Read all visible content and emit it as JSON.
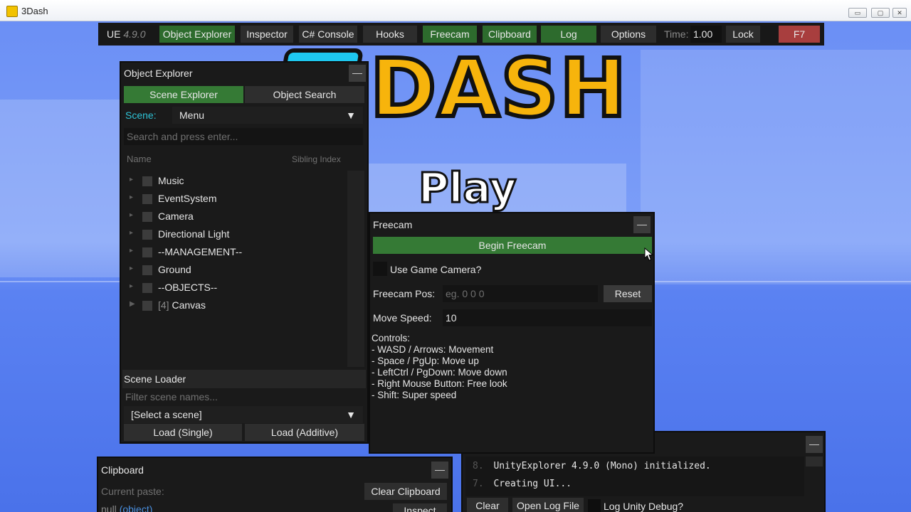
{
  "window": {
    "title": "3Dash",
    "minimize": "▭",
    "maximize": "▢",
    "close": "✕"
  },
  "game": {
    "logo": "DASH",
    "logo_d": "D",
    "play": "Play"
  },
  "navbar": {
    "ue_label": "UE",
    "version": "4.9.0",
    "tabs": [
      "Object Explorer",
      "Inspector",
      "C# Console",
      "Hooks",
      "Freecam",
      "Clipboard",
      "Log",
      "Options"
    ],
    "time_label": "Time:",
    "time_value": "1.00",
    "lock": "Lock",
    "f7": "F7"
  },
  "object_explorer": {
    "title": "Object Explorer",
    "minimize": "—",
    "tabs": [
      "Scene Explorer",
      "Object Search"
    ],
    "scene_label": "Scene:",
    "scene_value": "Menu",
    "dropdown_arrow": "▼",
    "search_placeholder": "Search and press enter...",
    "col_name": "Name",
    "col_sibling": "Sibling Index",
    "items": [
      {
        "arrow": "▸",
        "label": "Music",
        "count": ""
      },
      {
        "arrow": "▸",
        "label": "EventSystem",
        "count": ""
      },
      {
        "arrow": "▸",
        "label": "Camera",
        "count": ""
      },
      {
        "arrow": "▸",
        "label": "Directional Light",
        "count": ""
      },
      {
        "arrow": "▸",
        "label": "--MANAGEMENT--",
        "count": ""
      },
      {
        "arrow": "▸",
        "label": "Ground",
        "count": ""
      },
      {
        "arrow": "▸",
        "label": "--OBJECTS--",
        "count": ""
      },
      {
        "arrow": "▶",
        "label": "Canvas",
        "count": "[4]"
      }
    ],
    "scene_loader": {
      "title": "Scene Loader",
      "filter_placeholder": "Filter scene names...",
      "select_value": "[Select a scene]",
      "load_single": "Load (Single)",
      "load_additive": "Load (Additive)"
    }
  },
  "freecam": {
    "title": "Freecam",
    "minimize": "—",
    "begin": "Begin Freecam",
    "use_game_camera": "Use Game Camera?",
    "pos_label": "Freecam Pos:",
    "pos_placeholder": "eg. 0 0 0",
    "reset": "Reset",
    "speed_label": "Move Speed:",
    "speed_value": "10",
    "controls_title": "Controls:",
    "controls": [
      "- WASD / Arrows: Movement",
      "- Space / PgUp: Move up",
      "- LeftCtrl / PgDown: Move down",
      "- Right Mouse Button: Free look",
      "- Shift: Super speed"
    ]
  },
  "clipboard": {
    "title": "Clipboard",
    "minimize": "—",
    "current_paste_label": "Current paste:",
    "clear_button": "Clear Clipboard",
    "value_null": "null",
    "value_type": "(object)",
    "inspect_button": "Inspect"
  },
  "log": {
    "minimize": "—",
    "lines": [
      {
        "num": "8.",
        "text": "UnityExplorer 4.9.0 (Mono) initialized."
      },
      {
        "num": "7.",
        "text": "Creating UI..."
      }
    ],
    "clear": "Clear",
    "open_log": "Open Log File",
    "unity_debug": "Log Unity Debug?"
  },
  "colors": {
    "accent_green": "#357a35",
    "nav_active": "#2d6b2d",
    "f7_red": "#a83e3e",
    "scene_label": "#2ec3d6",
    "type_blue": "#4a8fe0",
    "panel_bg": "#1a1a1a"
  }
}
